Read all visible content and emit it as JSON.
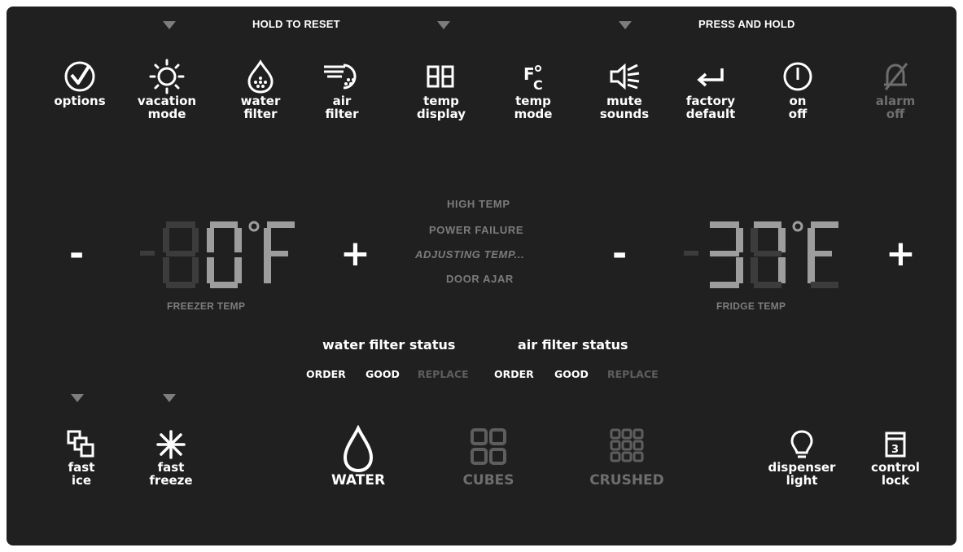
{
  "top_hints": {
    "hold_to_reset": "HOLD TO RESET",
    "press_and_hold": "PRESS AND HOLD"
  },
  "top_buttons": [
    {
      "icon": "checkmark-circle-icon",
      "line1": "options",
      "line2": ""
    },
    {
      "icon": "sun-icon",
      "line1": "vacation",
      "line2": "mode"
    },
    {
      "icon": "water-drop-filter-icon",
      "line1": "water",
      "line2": "filter"
    },
    {
      "icon": "air-filter-icon",
      "line1": "air",
      "line2": "filter"
    },
    {
      "icon": "digits-88-icon",
      "line1": "temp",
      "line2": "display"
    },
    {
      "icon": "f-c-icon",
      "line1": "temp",
      "line2": "mode"
    },
    {
      "icon": "speaker-mute-icon",
      "line1": "mute",
      "line2": "sounds"
    },
    {
      "icon": "return-arrow-icon",
      "line1": "factory",
      "line2": "default"
    },
    {
      "icon": "power-icon",
      "line1": "on",
      "line2": "off"
    },
    {
      "icon": "bell-off-icon",
      "line1": "alarm",
      "line2": "off"
    }
  ],
  "freezer": {
    "minus": "-",
    "plus": "+",
    "value": "0",
    "unit": "F",
    "label": "FREEZER TEMP"
  },
  "fridge": {
    "minus": "-",
    "plus": "+",
    "value": "37",
    "unit": "F",
    "label": "FRIDGE TEMP"
  },
  "status_messages": [
    "HIGH TEMP",
    "POWER FAILURE",
    "ADJUSTING TEMP...",
    "DOOR AJAR"
  ],
  "filter_status": {
    "water_title": "water filter status",
    "air_title": "air filter status",
    "water_items": [
      "ORDER",
      "GOOD",
      "REPLACE"
    ],
    "air_items": [
      "ORDER",
      "GOOD",
      "REPLACE"
    ]
  },
  "bottom_buttons": [
    {
      "icon": "fast-ice-cubes-icon",
      "line1": "fast",
      "line2": "ice"
    },
    {
      "icon": "snowflake-icon",
      "line1": "fast",
      "line2": "freeze"
    },
    {
      "icon": "water-drop-icon",
      "line1": "WATER",
      "line2": ""
    },
    {
      "icon": "ice-cubes-icon",
      "line1": "CUBES",
      "line2": ""
    },
    {
      "icon": "crushed-ice-icon",
      "line1": "CRUSHED",
      "line2": ""
    },
    {
      "icon": "light-bulb-icon",
      "line1": "dispenser",
      "line2": "light"
    },
    {
      "icon": "lock-icon",
      "line1": "control",
      "line2": "lock"
    }
  ],
  "colors": {
    "panel": "#202020",
    "active": "#ffffff",
    "inactive": "#6e6e6e",
    "segment_dim": "#3c3c3c"
  }
}
